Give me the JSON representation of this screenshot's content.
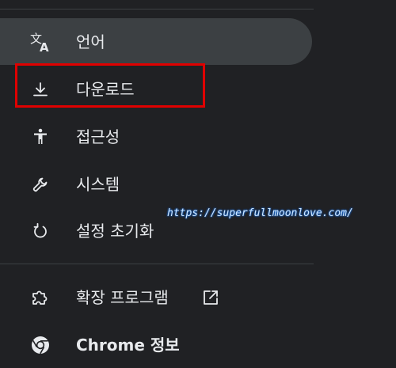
{
  "menu": {
    "items": [
      {
        "label": "언어",
        "icon": "translate-icon",
        "active": true
      },
      {
        "label": "다운로드",
        "icon": "download-icon",
        "active": false
      },
      {
        "label": "접근성",
        "icon": "accessibility-icon",
        "active": false
      },
      {
        "label": "시스템",
        "icon": "wrench-icon",
        "active": false
      },
      {
        "label": "설정 초기화",
        "icon": "reset-icon",
        "active": false
      }
    ],
    "extensions_label": "확장 프로그램",
    "extensions_icon": "extension-puzzle-icon",
    "about_label": "Chrome 정보",
    "about_icon": "chrome-logo-icon"
  },
  "watermark": "https://superfullmoonlove.com/",
  "colors": {
    "background": "#202124",
    "active_background": "#3c4043",
    "text": "#e8eaed",
    "icon": "#e8eaed",
    "highlight_border": "#e00000"
  }
}
